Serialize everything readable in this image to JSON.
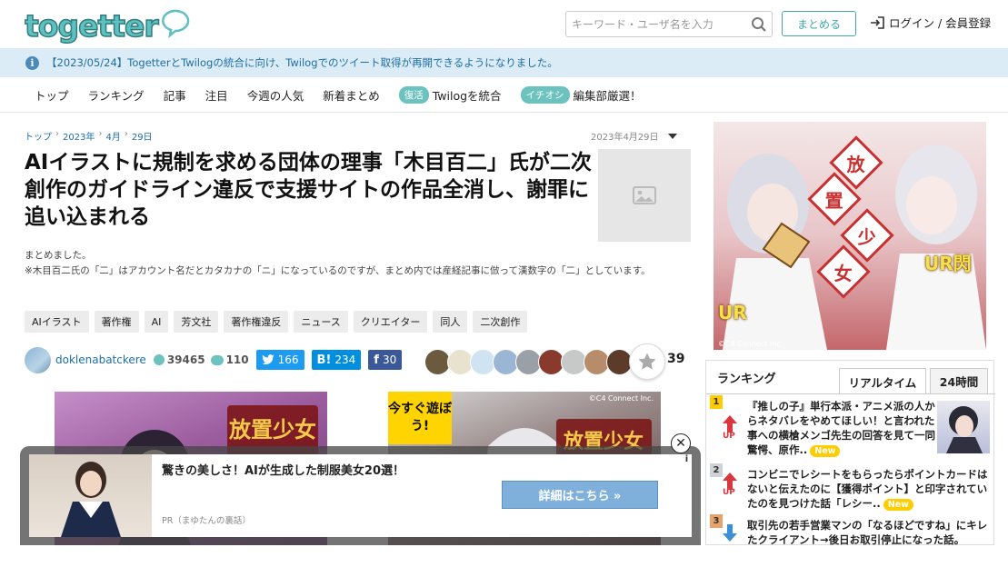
{
  "header": {
    "logo_text": "togetter",
    "search_placeholder": "キーワード・ユーザ名を入力",
    "matome_button": "まとめる",
    "login_label": "ログイン / 会員登録"
  },
  "notice": {
    "text": "【2023/05/24】TogetterとTwilogの統合に向け、Twilogでのツイート取得が再開できるようになりました。"
  },
  "nav": {
    "items": [
      "トップ",
      "ランキング",
      "記事",
      "注目",
      "今週の人気",
      "新着まとめ"
    ],
    "twilog_tag": "復活",
    "twilog_label": "Twilogを統合",
    "editor_tag": "イチオシ",
    "editor_label": "編集部厳選！"
  },
  "article": {
    "breadcrumb": [
      "トップ",
      "2023年",
      "4月",
      "29日"
    ],
    "date": "2023年4月29日",
    "title": "AIイラストに規制を求める団体の理事「木目百二」氏が二次創作のガイドライン違反で支援サイトの作品全消し、謝罪に追い込まれる",
    "desc_line1": "まとめました。",
    "desc_line2": "※木目百二氏の「二」はアカウント名だとカタカナの「ニ」になっているのですが、まとめ内では産経記事に倣って漢数字の「二」としています。",
    "tags": [
      "AIイラスト",
      "著作権",
      "AI",
      "芳文社",
      "著作権違反",
      "ニュース",
      "クリエイター",
      "同人",
      "二次創作"
    ],
    "author": "doklenabatckere",
    "views": "39465",
    "comments": "110",
    "twitter_count": "166",
    "hatena_label": "B!",
    "hatena_count": "234",
    "facebook_count": "30",
    "favorites_count": "39"
  },
  "ads": {
    "ad2_headline": "今すぐ遊ぼう!",
    "ad2_copyright": "©C4 Connect Inc.",
    "side_kanji": [
      "放",
      "置",
      "少",
      "女"
    ],
    "side_ur1": "UR閃",
    "side_ur2": "UR",
    "side_copyright": "©C4 Connect Inc."
  },
  "popup": {
    "title": "驚きの美しさ！AIが生成した制服美女20選！",
    "source": "PR（まゆたんの裏話）",
    "button": "詳細はこちら »",
    "info": "i",
    "close": "✕"
  },
  "ranking": {
    "heading": "ランキング",
    "tab_realtime": "リアルタイム",
    "tab_24h": "24時間",
    "up_label": "UP",
    "new_label": "New",
    "items": [
      {
        "rank": "1",
        "title": "『推しの子』単行本派・アニメ派の人からネタバレをやめてほしい！と言われた事への横槍メンゴ先生の回答を見て一同驚愕、原作.."
      },
      {
        "rank": "2",
        "title": "コンビニでレシートをもらったらポイントカードはないと伝えたのに【獲得ポイント】と印字されていたのを見つけた話「レシー.."
      },
      {
        "rank": "3",
        "title": "取引先の若手営業マンの「なるほどですね」にキレたクライアント→後日お取引停止になった話。"
      }
    ]
  },
  "colors": {
    "brand_teal": "#3fa9a9",
    "notice_bg": "#dcecf6",
    "twitter": "#1d9bf0",
    "hatena": "#008fde",
    "facebook": "#3b5998",
    "rank_gold": "#ffcc00",
    "up_red": "#d9363e"
  }
}
